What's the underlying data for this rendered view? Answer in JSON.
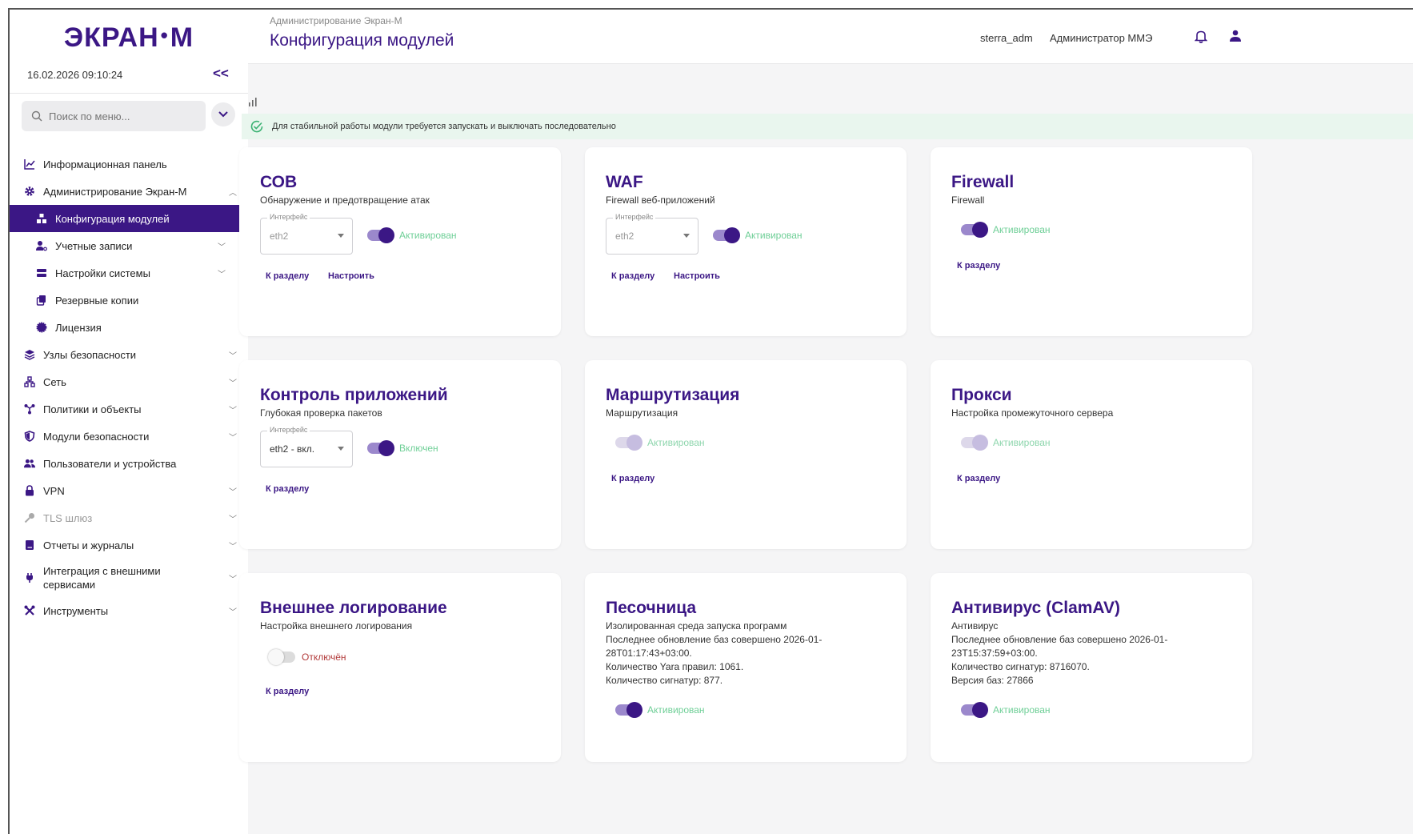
{
  "sidebar": {
    "logo_left": "ЭКРАН",
    "logo_dot": "•",
    "logo_right": "М",
    "datetime": "16.02.2026 09:10:24",
    "collapse": "<<",
    "search_placeholder": "Поиск по меню...",
    "items": [
      {
        "label": "Информационная панель",
        "icon": "chart-line-icon"
      },
      {
        "label": "Администрирование Экран-М",
        "icon": "gear-icon",
        "expanded": true
      },
      {
        "label": "Конфигурация модулей",
        "icon": "modules-icon",
        "active": true
      },
      {
        "label": "Учетные записи",
        "icon": "user-key-icon"
      },
      {
        "label": "Настройки системы",
        "icon": "server-icon"
      },
      {
        "label": "Резервные копии",
        "icon": "copy-icon"
      },
      {
        "label": "Лицензия",
        "icon": "seal-icon"
      },
      {
        "label": "Узлы безопасности",
        "icon": "layers-icon"
      },
      {
        "label": "Сеть",
        "icon": "network-icon"
      },
      {
        "label": "Политики и объекты",
        "icon": "graph-icon"
      },
      {
        "label": "Модули безопасности",
        "icon": "shield-icon"
      },
      {
        "label": "Пользователи и устройства",
        "icon": "users-icon"
      },
      {
        "label": "VPN",
        "icon": "lock-icon"
      },
      {
        "label": "TLS шлюз",
        "icon": "key-icon",
        "disabled": true
      },
      {
        "label": "Отчеты и журналы",
        "icon": "book-icon"
      },
      {
        "label": "Интеграция с внешними сервисами",
        "icon": "plug-icon"
      },
      {
        "label": "Инструменты",
        "icon": "tools-icon"
      }
    ]
  },
  "header": {
    "breadcrumb": "Администрирование Экран-М",
    "title": "Конфигурация модулей",
    "user_login": "sterra_adm",
    "user_role": "Администратор ММЭ"
  },
  "notice": "Для стабильной работы модули требуется запускать и выключать последовательно",
  "interface_legend": "Интерфейс",
  "link_section": "К разделу",
  "link_configure": "Настроить",
  "cards": [
    {
      "title": "СОВ",
      "subtitle": "Обнаружение и предотвращение атак",
      "interface": "eth2",
      "toggle": "Активирован"
    },
    {
      "title": "WAF",
      "subtitle": "Firewall веб-приложений",
      "interface": "eth2",
      "toggle": "Активирован"
    },
    {
      "title": "Firewall",
      "subtitle": "Firewall",
      "toggle": "Активирован"
    },
    {
      "title": "Контроль приложений",
      "subtitle": "Глубокая проверка пакетов",
      "interface": "eth2 - вкл.",
      "toggle": "Включен"
    },
    {
      "title": "Маршрутизация",
      "subtitle": "Маршрутизация",
      "toggle": "Активирован"
    },
    {
      "title": "Прокси",
      "subtitle": "Настройка промежуточного сервера",
      "toggle": "Активирован"
    },
    {
      "title": "Внешнее логирование",
      "subtitle": "Настройка внешнего логирования",
      "toggle": "Отключён"
    },
    {
      "title": "Песочница",
      "subtitle": "Изолированная среда запуска программ",
      "details": [
        "Последнее обновление баз совершено 2026-01-",
        "28T01:17:43+03:00.",
        "Количество Yara правил: 1061.",
        "Количество сигнатур: 877."
      ],
      "toggle": "Активирован"
    },
    {
      "title": "Антивирус (ClamAV)",
      "subtitle": "Антивирус",
      "details": [
        "Последнее обновление баз совершено 2026-01-",
        "23T15:37:59+03:00.",
        "Количество сигнатур: 8716070.",
        "Версия баз: 27866"
      ],
      "toggle": "Активирован"
    }
  ],
  "colors": {
    "accent": "#3b1785",
    "success": "#6fcf97",
    "danger": "#b23a3a",
    "notice_bg": "#e9f6ee"
  }
}
